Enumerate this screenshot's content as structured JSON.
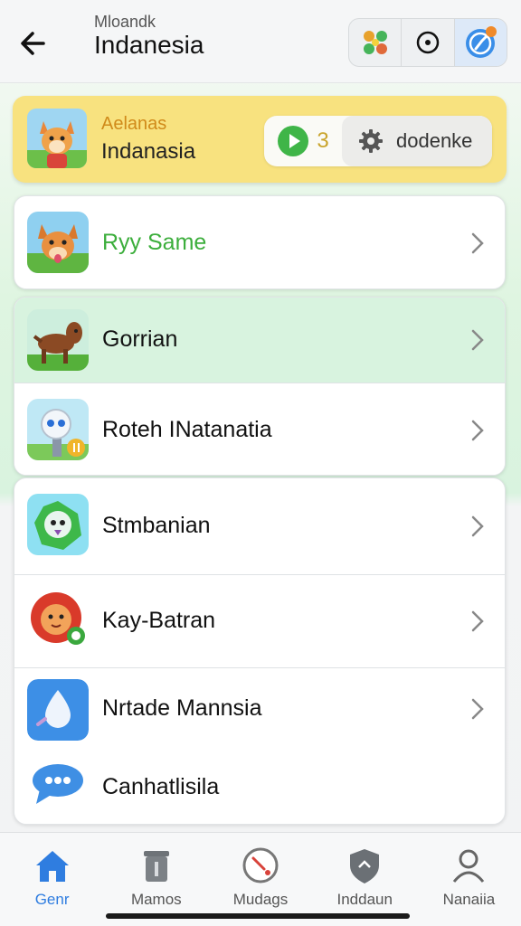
{
  "header": {
    "subtitle": "Mloandk",
    "title": "Indanesia",
    "icons": [
      "back-arrow-icon",
      "puzzle-icon",
      "record-icon",
      "compass-icon"
    ]
  },
  "banner": {
    "tag": "Aelanas",
    "name": "Indanasia",
    "count": "3",
    "settings_label": "dodenke"
  },
  "items": [
    {
      "label": "Ryy Same",
      "icon": "dog-avatar-icon"
    },
    {
      "label": "Gorrian",
      "icon": "horse-icon"
    },
    {
      "label": "Roteh INatanatia",
      "icon": "robot-icon"
    },
    {
      "label": "Stmbanian",
      "icon": "green-monster-icon"
    },
    {
      "label": "Kay-Batran",
      "icon": "lion-icon"
    },
    {
      "label": "Nrtade Mannsia",
      "icon": "water-drop-icon"
    },
    {
      "label": "Canhatlisila",
      "icon": "chat-bubble-icon"
    }
  ],
  "nav": [
    {
      "label": "Genr",
      "icon": "home-icon",
      "active": true
    },
    {
      "label": "Mamos",
      "icon": "trash-icon"
    },
    {
      "label": "Mudags",
      "icon": "gauge-icon"
    },
    {
      "label": "Inddaun",
      "icon": "shield-icon"
    },
    {
      "label": "Nanaiia",
      "icon": "user-icon"
    }
  ],
  "colors": {
    "accent": "#2f7de0",
    "banner": "#f8e27f",
    "tint": "#d8f3df",
    "green_label": "#3cae3c"
  }
}
